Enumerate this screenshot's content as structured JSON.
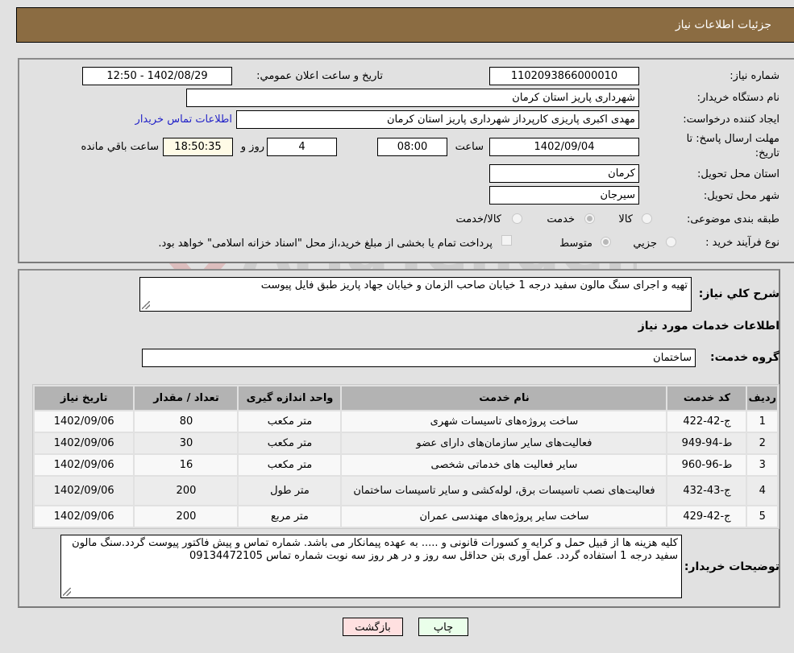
{
  "header": {
    "title": "جزئیات اطلاعات نیاز"
  },
  "form": {
    "need_number": {
      "label": "شماره نیاز:",
      "value": "1102093866000010"
    },
    "announce": {
      "label": "تاریخ و ساعت اعلان عمومي:",
      "value": "1402/08/29 - 12:50"
    },
    "buyer_org": {
      "label": "نام دستگاه خریدار:",
      "value": "شهرداری پاریز استان کرمان"
    },
    "requester": {
      "label": "ایجاد کننده درخواست:",
      "value": "مهدی اکبری پاریزی کارپرداز شهرداری پاریز استان کرمان",
      "contact_link": "اطلاعات تماس خریدار"
    },
    "deadline": {
      "label": "مهلت ارسال پاسخ: تا تاریخ:",
      "date": "1402/09/04",
      "time_label": "ساعت",
      "time": "08:00",
      "days": "4",
      "days_label": "روز و",
      "remaining": "18:50:35",
      "remaining_label": "ساعت باقي مانده"
    },
    "province": {
      "label": "استان محل تحویل:",
      "value": "کرمان"
    },
    "city": {
      "label": "شهر محل تحویل:",
      "value": "سیرجان"
    },
    "category": {
      "label": "طبقه بندی موضوعی:",
      "options": [
        {
          "label": "کالا",
          "checked": false
        },
        {
          "label": "خدمت",
          "checked": true
        },
        {
          "label": "کالا/خدمت",
          "checked": false
        }
      ]
    },
    "purchase_type": {
      "label": "نوع فرآیند خرید :",
      "options": [
        {
          "label": "جزیي",
          "checked": false
        },
        {
          "label": "متوسط",
          "checked": true
        }
      ],
      "treasury_checkbox_label": "پرداخت تمام یا بخشی از مبلغ خرید،از محل \"اسناد خزانه اسلامی\" خواهد بود.",
      "treasury_checked": false
    }
  },
  "details": {
    "description_label": "شرح کلي نیاز:",
    "description": "تهیه و اجرای سنگ مالون سفید درجه 1 خیابان صاحب الزمان و خیابان جهاد پاریز طبق فایل پیوست",
    "services_title": "اطلاعات خدمات مورد نیاز",
    "service_group_label": "گروه خدمت:",
    "service_group": "ساختمان",
    "table": {
      "headers": [
        "ردیف",
        "کد خدمت",
        "نام خدمت",
        "واحد اندازه گیری",
        "تعداد / مقدار",
        "تاریخ نیاز"
      ],
      "rows": [
        [
          "1",
          "ج-42-422",
          "ساخت پروژه‌های تاسیسات شهری",
          "متر مکعب",
          "80",
          "1402/09/06"
        ],
        [
          "2",
          "ط-94-949",
          "فعالیت‌های سایر سازمان‌های دارای عضو",
          "متر مکعب",
          "30",
          "1402/09/06"
        ],
        [
          "3",
          "ط-96-960",
          "سایر فعالیت های خدماتی شخصی",
          "متر مکعب",
          "16",
          "1402/09/06"
        ],
        [
          "4",
          "ج-43-432",
          "فعالیت‌های نصب تاسیسات برق، لوله‌کشی و سایر تاسیسات ساختمان",
          "متر طول",
          "200",
          "1402/09/06"
        ],
        [
          "5",
          "ج-42-429",
          "ساخت سایر پروژه‌های مهندسی عمران",
          "متر مربع",
          "200",
          "1402/09/06"
        ]
      ]
    },
    "buyer_notes_label": "توضیحات خریدار:",
    "buyer_notes": "کلیه هزینه ها از قبیل حمل و کرایه و کسورات قانونی و ..... به عهده پیمانکار می باشد. شماره تماس و پیش فاکتور پیوست گردد.سنگ مالون سفید درجه 1 استفاده گردد. عمل آوری بتن حداقل سه روز و در هر روز سه نوبت شماره تماس 09134472105"
  },
  "buttons": {
    "print": "چاپ",
    "back": "بازگشت"
  },
  "watermark": {
    "text": "AriaTender.neT"
  }
}
